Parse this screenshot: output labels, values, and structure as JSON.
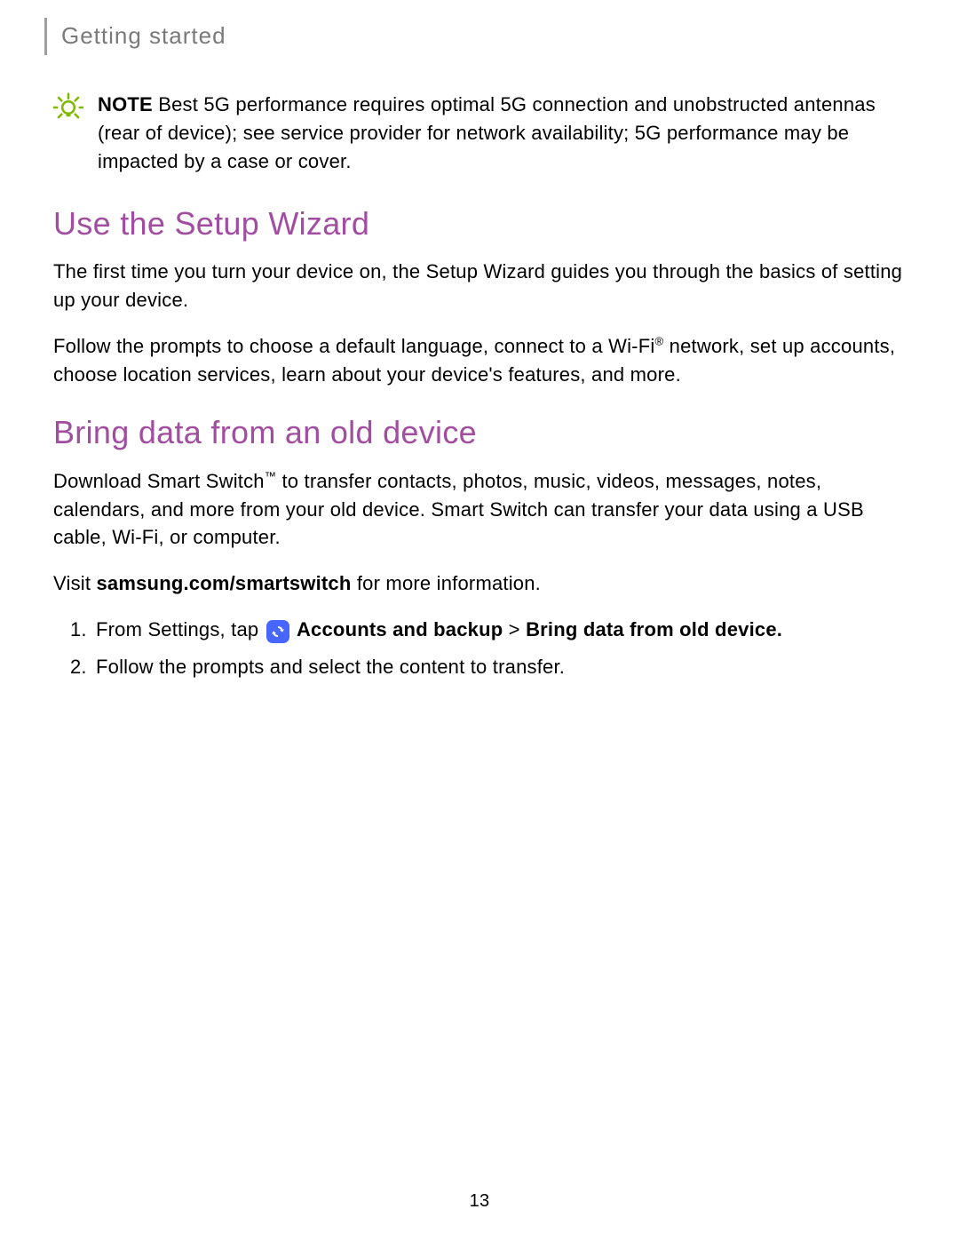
{
  "header": {
    "section_label": "Getting started"
  },
  "note": {
    "label": "NOTE",
    "text": " Best 5G performance requires optimal 5G connection and unobstructed antennas (rear of device); see service provider for network availability; 5G performance may be impacted by a case or cover."
  },
  "section1": {
    "title": "Use the Setup Wizard",
    "para1": "The first time you turn your device on, the Setup Wizard guides you through the basics of setting up your device.",
    "para2_a": "Follow the prompts to choose a default language, connect to a Wi-Fi",
    "para2_sup": "®",
    "para2_b": " network, set up accounts, choose location services, learn about your device's features, and more."
  },
  "section2": {
    "title": "Bring data from an old device",
    "para1_a": "Download Smart Switch",
    "para1_sup": "™",
    "para1_b": " to transfer contacts, photos, music, videos, messages, notes, calendars, and more from your old device. Smart Switch can transfer your data using a USB cable, Wi-Fi, or computer.",
    "para2_a": "Visit ",
    "para2_bold": "samsung.com/smartswitch",
    "para2_b": " for more information.",
    "steps": {
      "s1_a": "From Settings, tap ",
      "s1_bold1": "Accounts and backup",
      "s1_sep": " > ",
      "s1_bold2": "Bring data from old device.",
      "s2": "Follow the prompts and select the content to transfer."
    }
  },
  "page_number": "13"
}
